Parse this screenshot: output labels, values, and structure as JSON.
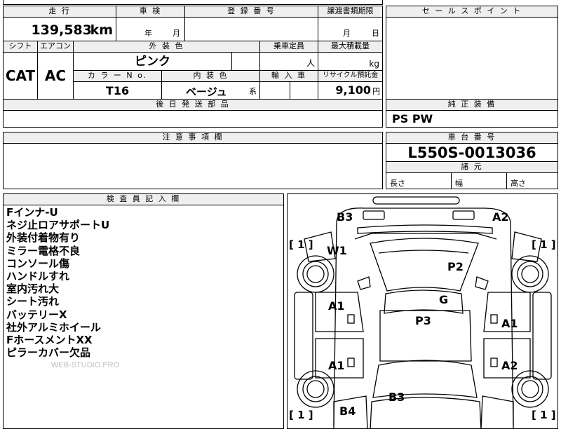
{
  "top": {
    "mileage_header": "走 行",
    "mileage_value": "139,583",
    "mileage_unit": "km",
    "inspection_header": "車 検",
    "inspection_year": "年",
    "inspection_month": "月",
    "registration_header": "登 録 番 号",
    "transfer_header": "譲渡書類期限",
    "transfer_month": "月",
    "transfer_day": "日"
  },
  "spec": {
    "shift_header": "シフト",
    "shift_value": "CAT",
    "aircon_header": "エアコン",
    "aircon_value": "AC",
    "exterior_header": "外 装 色",
    "exterior_value": "ピンク",
    "capacity_header": "乗車定員",
    "capacity_unit": "人",
    "load_header": "最大積載量",
    "load_unit": "kg",
    "color_no_header": "カ ラ ー N o.",
    "color_no_value": "T16",
    "interior_header": "内 装 色",
    "interior_value": "ベージュ",
    "interior_suffix": "系",
    "import_header": "輸 入 車",
    "recycle_header": "リサイクル預託金",
    "recycle_value": "9,100",
    "recycle_unit": "円"
  },
  "later_parts": {
    "header": "後 日 発 送 部 品"
  },
  "caution": {
    "header": "注 意 事 項 欄"
  },
  "sales": {
    "header": "セ ー ル ス ポ イ ン ト"
  },
  "equipment": {
    "header": "純 正 装 備",
    "value": "PS PW"
  },
  "chassis": {
    "header": "車 台 番 号",
    "value": "L550S-0013036",
    "dims_header": "諸 元",
    "length": "長さ",
    "width": "幅",
    "height": "高さ"
  },
  "inspector": {
    "header": "検 査 員 記 入 欄",
    "notes": [
      "Fインナ-U",
      "ネジ止ロアサポートU",
      "外装付着物有り",
      "ミラー電格不良",
      "コンソール傷",
      "ハンドルすれ",
      "室内汚れ大",
      "シート汚れ",
      "バッテリーX",
      "社外アルミホイール",
      "FホースメントXX",
      "ピラーカバー欠品"
    ],
    "watermark": "WEB-STUDIO.PRO"
  },
  "diagram": {
    "labels": {
      "b3_top": "B3",
      "a2_top": "A2",
      "w1": "W1",
      "p2": "P2",
      "g": "G",
      "a1_left_upper": "A1",
      "p3": "P3",
      "a1_right_upper": "A1",
      "a1_left_lower": "A1",
      "a2_right_lower": "A2",
      "b3_bottom": "B3",
      "b4": "B4"
    },
    "tire_marks": {
      "front_left": "[ 1 ]",
      "front_right": "[ 1 ]",
      "rear_left": "[ 1 ]",
      "rear_right": "[ 1 ]"
    }
  }
}
